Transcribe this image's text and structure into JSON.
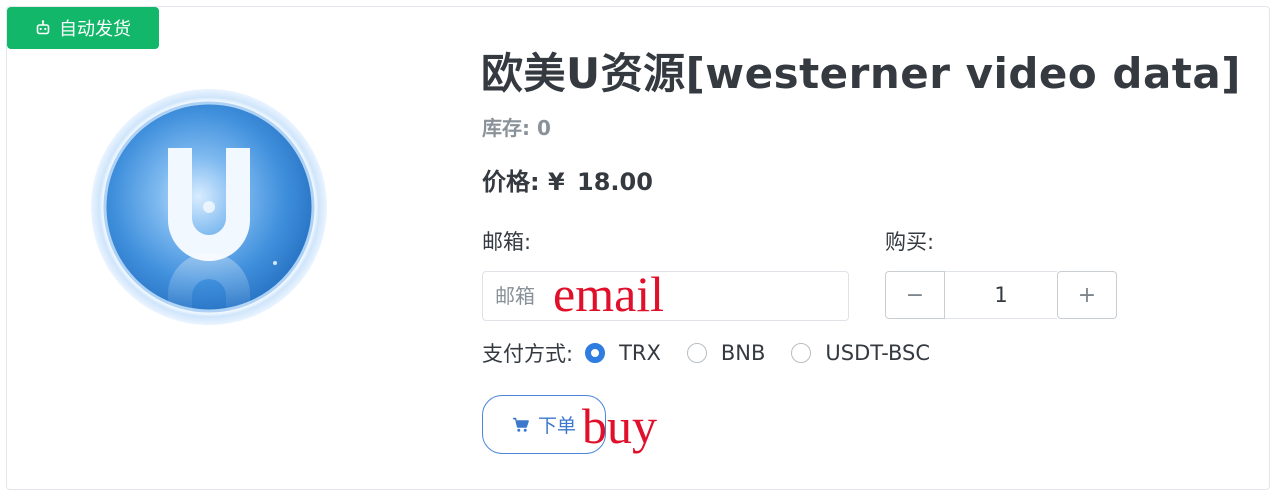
{
  "badge": {
    "label": "自动发货"
  },
  "product": {
    "title": "欧美U资源[westerner video data]",
    "stock_label": "库存:",
    "stock_value": "0",
    "price_label": "价格:",
    "currency": "¥",
    "price_value": "18.00"
  },
  "form": {
    "email_label": "邮箱:",
    "email_placeholder": "邮箱",
    "quantity_label": "购买:",
    "quantity_value": "1",
    "minus_label": "−",
    "plus_label": "+",
    "payment_label": "支付方式:",
    "payment_options": [
      "TRX",
      "BNB",
      "USDT-BSC"
    ],
    "selected_payment": "TRX",
    "buy_label": "下单"
  },
  "annotations": {
    "email": "email",
    "buy": "buy"
  },
  "colors": {
    "badge": "#12b76a",
    "accent": "#2f7de1",
    "annotation": "#e0102a"
  }
}
